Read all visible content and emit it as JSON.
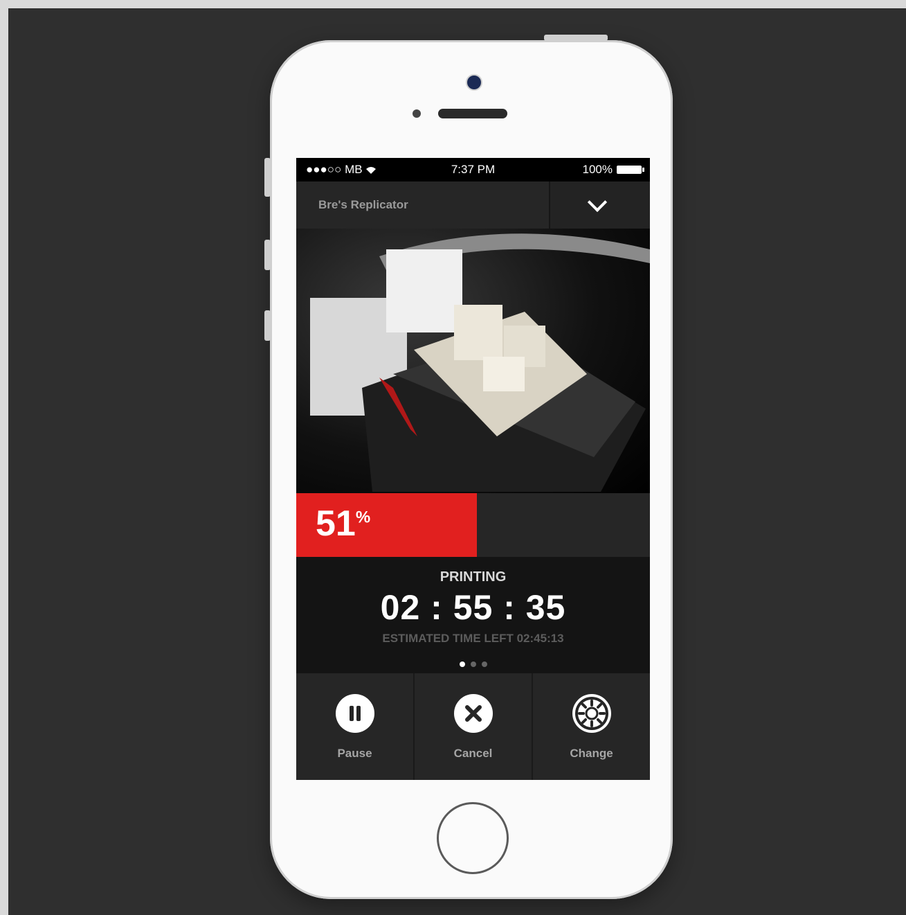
{
  "statusbar": {
    "carrier": "●●●○○ MB",
    "time": "7:37 PM",
    "battery": "100%"
  },
  "header": {
    "printer_name": "Bre's Replicator"
  },
  "progress": {
    "percent": 51,
    "number": "51",
    "suffix": "%"
  },
  "job": {
    "status": "PRINTING",
    "elapsed": "02 : 55 : 35",
    "estimate": "ESTIMATED TIME LEFT 02:45:13",
    "page_count": 3,
    "active_page": 1
  },
  "actions": [
    {
      "label": "Pause",
      "icon": "pause-icon"
    },
    {
      "label": "Cancel",
      "icon": "close-icon"
    },
    {
      "label": "Change",
      "icon": "filament-spool-icon"
    }
  ],
  "colors": {
    "accent": "#e1201f",
    "background": "#2f2f2f"
  }
}
